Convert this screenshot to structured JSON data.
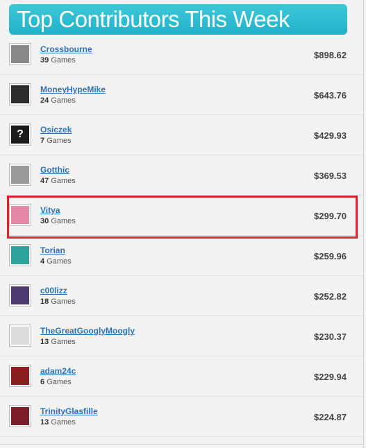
{
  "header": {
    "title": "Top Contributors This Week"
  },
  "contributors": [
    {
      "name": "Crossbourne",
      "count": "39",
      "games_label": "Games",
      "amount": "$898.62",
      "avatar_icon": "skull-avatar-icon",
      "color": "#8a8a8a"
    },
    {
      "name": "MoneyHypeMike",
      "count": "24",
      "games_label": "Games",
      "amount": "$643.76",
      "avatar_icon": "dark-blob-avatar-icon",
      "color": "#2b2b2b"
    },
    {
      "name": "Osiczek",
      "count": "7",
      "games_label": "Games",
      "amount": "$429.93",
      "avatar_icon": "question-mark-avatar-icon",
      "color": "#1a1a1a"
    },
    {
      "name": "Gotthic",
      "count": "47",
      "games_label": "Games",
      "amount": "$369.53",
      "avatar_icon": "grey-character-avatar-icon",
      "color": "#9a9a9a"
    },
    {
      "name": "Vitya",
      "count": "30",
      "games_label": "Games",
      "amount": "$299.70",
      "avatar_icon": "anime-girl-avatar-icon",
      "color": "#e48aa8"
    },
    {
      "name": "Torian",
      "count": "4",
      "games_label": "Games",
      "amount": "$259.96",
      "avatar_icon": "teal-hair-avatar-icon",
      "color": "#2fa39a"
    },
    {
      "name": "c00lizz",
      "count": "18",
      "games_label": "Games",
      "amount": "$252.82",
      "avatar_icon": "purple-character-avatar-icon",
      "color": "#4b3a6e"
    },
    {
      "name": "TheGreatGooglyMoogly",
      "count": "13",
      "games_label": "Games",
      "amount": "$230.37",
      "avatar_icon": "sketch-avatar-icon",
      "color": "#dcdcdc"
    },
    {
      "name": "adam24c",
      "count": "6",
      "games_label": "Games",
      "amount": "$229.94",
      "avatar_icon": "red-armor-avatar-icon",
      "color": "#8a1e1e"
    },
    {
      "name": "TrinityGlasfille",
      "count": "13",
      "games_label": "Games",
      "amount": "$224.87",
      "avatar_icon": "red-hair-avatar-icon",
      "color": "#7a1f2a"
    }
  ],
  "highlight_color": "#e1202b",
  "accent_color": "#2ab9cd",
  "link_color": "#2a73b8"
}
